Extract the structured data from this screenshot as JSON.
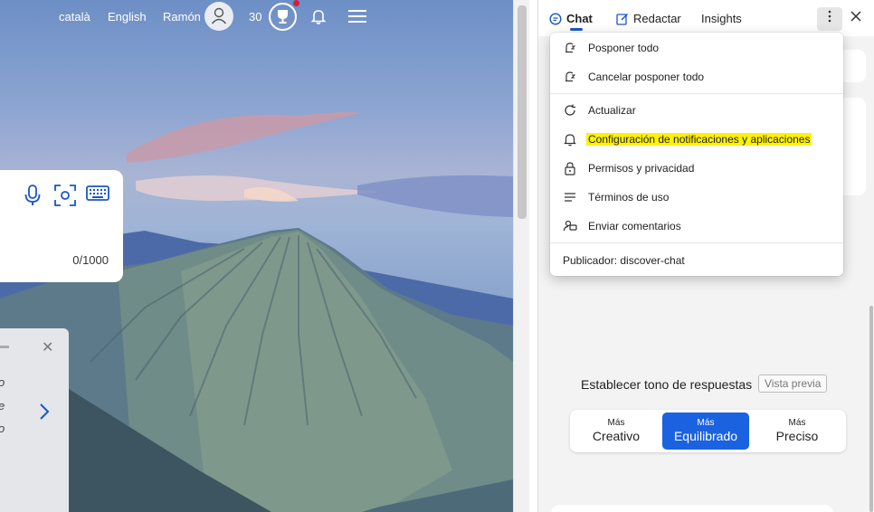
{
  "topbar": {
    "lang1": "català",
    "lang2": "English",
    "user": "Ramón",
    "points": "30"
  },
  "search": {
    "counter": "0/1000"
  },
  "promo": {
    "frag1": "o",
    "frag2": "e",
    "frag3": "o"
  },
  "panel": {
    "tabs": [
      "Chat",
      "Redactar",
      "Insights"
    ],
    "menu": {
      "items": [
        "Posponer todo",
        "Cancelar posponer todo",
        "Actualizar",
        "Configuración de notificaciones y aplicaciones",
        "Permisos y privacidad",
        "Términos de uso",
        "Enviar comentarios"
      ],
      "publisher": "Publicador: discover-chat"
    },
    "tone": {
      "title": "Establecer tono de respuestas",
      "preview": "Vista previa",
      "options": [
        {
          "small": "Más",
          "big": "Creativo"
        },
        {
          "small": "Más",
          "big": "Equilibrado"
        },
        {
          "small": "Más",
          "big": "Preciso"
        }
      ]
    }
  },
  "colors": {
    "accent": "#1a62e0",
    "highlight": "#fff200",
    "notification_dot": "#d21f3c"
  }
}
